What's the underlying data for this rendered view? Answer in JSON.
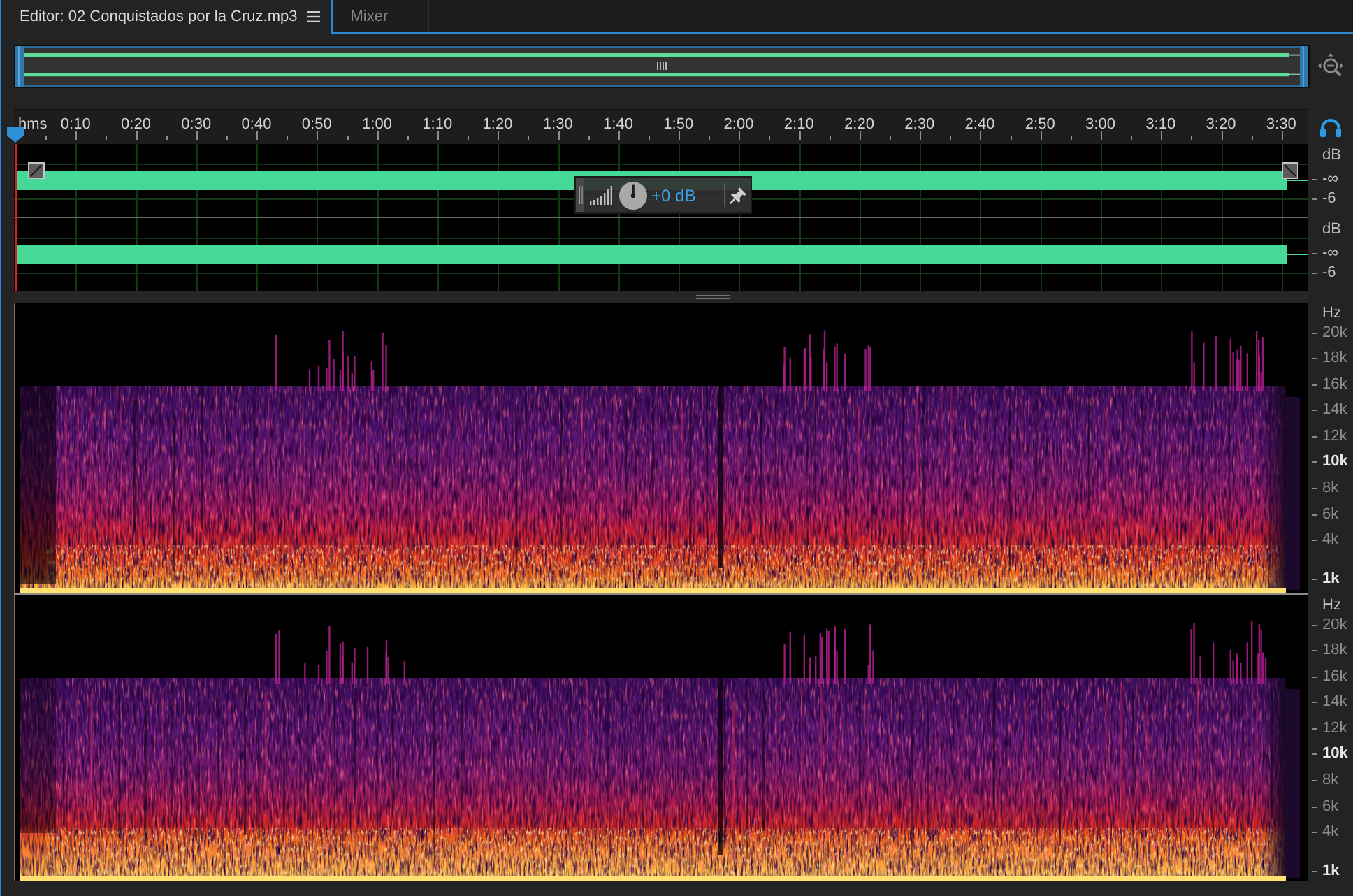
{
  "tabs": [
    {
      "label": "Editor: 02 Conquistados por la Cruz.mp3",
      "selected": true
    },
    {
      "label": "Mixer",
      "selected": false
    }
  ],
  "ruler": {
    "unit": "hms",
    "labels": [
      "0:10",
      "0:20",
      "0:30",
      "0:40",
      "0:50",
      "1:00",
      "1:10",
      "1:20",
      "1:30",
      "1:40",
      "1:50",
      "2:00",
      "2:10",
      "2:20",
      "2:30",
      "2:40",
      "2:50",
      "3:00",
      "3:10",
      "3:20",
      "3:30"
    ]
  },
  "waveform": {
    "channels": [
      {
        "unit": "dB",
        "ticks": [
          "-∞",
          "-6"
        ]
      },
      {
        "unit": "dB",
        "ticks": [
          "-∞",
          "-6"
        ]
      }
    ],
    "gain_hud": {
      "value": "+0 dB"
    }
  },
  "spectrogram": {
    "channels": [
      {
        "unit": "Hz",
        "ticks": [
          {
            "label": "20k",
            "emphasized": false
          },
          {
            "label": "18k",
            "emphasized": false
          },
          {
            "label": "16k",
            "emphasized": false
          },
          {
            "label": "14k",
            "emphasized": false
          },
          {
            "label": "12k",
            "emphasized": false
          },
          {
            "label": "10k",
            "emphasized": true
          },
          {
            "label": "8k",
            "emphasized": false
          },
          {
            "label": "6k",
            "emphasized": false
          },
          {
            "label": "4k",
            "emphasized": false
          },
          {
            "label": "1k",
            "emphasized": true
          }
        ]
      },
      {
        "unit": "Hz",
        "ticks": [
          {
            "label": "20k",
            "emphasized": false
          },
          {
            "label": "18k",
            "emphasized": false
          },
          {
            "label": "16k",
            "emphasized": false
          },
          {
            "label": "14k",
            "emphasized": false
          },
          {
            "label": "12k",
            "emphasized": false
          },
          {
            "label": "10k",
            "emphasized": true
          },
          {
            "label": "8k",
            "emphasized": false
          },
          {
            "label": "6k",
            "emphasized": false
          },
          {
            "label": "4k",
            "emphasized": false
          },
          {
            "label": "1k",
            "emphasized": true
          }
        ]
      }
    ]
  }
}
